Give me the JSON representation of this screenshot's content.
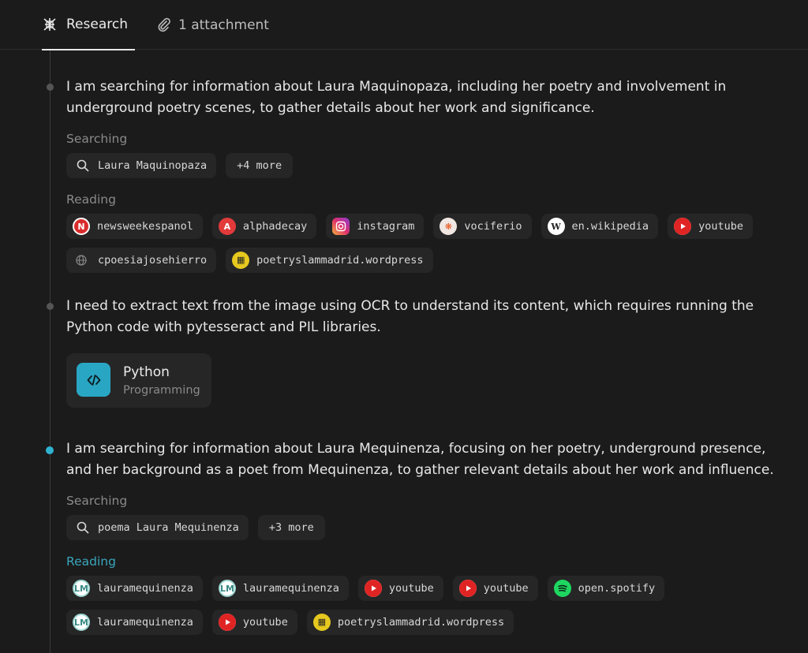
{
  "tabs": {
    "research": "Research",
    "attachments": "1 attachment"
  },
  "steps": [
    {
      "text": "I am searching for information about Laura Maquinopaza, including her poetry and involvement in underground poetry scenes, to gather details about her work and significance.",
      "searching_label": "Searching",
      "search_query": "Laura Maquinopaza",
      "search_more": "+4 more",
      "reading_label": "Reading",
      "sources": [
        "newsweekespanol",
        "alphadecay",
        "instagram",
        "vociferio",
        "en.wikipedia",
        "youtube",
        "cpoesiajosehierro",
        "poetryslammadrid.wordpress"
      ]
    },
    {
      "text": "I need to extract text from the image using OCR to understand its content, which requires running the Python code with pytesseract and PIL libraries.",
      "tool_title": "Python",
      "tool_subtitle": "Programming"
    },
    {
      "text": "I am searching for information about Laura Mequinenza, focusing on her poetry, underground presence, and her background as a poet from Mequinenza, to gather relevant details about her work and influence.",
      "searching_label": "Searching",
      "search_query": "poema Laura Mequinenza",
      "search_more": "+3 more",
      "reading_label": "Reading",
      "sources": [
        "lauramequinenza",
        "lauramequinenza",
        "youtube",
        "youtube",
        "open.spotify",
        "lauramequinenza",
        "youtube",
        "poetryslammadrid.wordpress"
      ]
    }
  ],
  "colors": {
    "background": "#1b1b1b",
    "chip": "#262626",
    "accent": "#2fb3d1",
    "muted": "#8a8a8a"
  },
  "icons": {
    "research_tab": "research-logo-icon",
    "attachment_tab": "paperclip-icon",
    "search": "search-icon",
    "tool": "code-icon"
  }
}
